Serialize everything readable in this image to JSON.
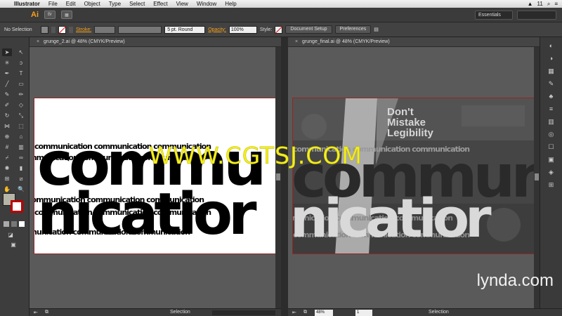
{
  "menubar": {
    "app": "Illustrator",
    "items": [
      "File",
      "Edit",
      "Object",
      "Type",
      "Select",
      "Effect",
      "View",
      "Window",
      "Help"
    ],
    "right_text": "11"
  },
  "appbar": {
    "logo": "Ai",
    "chip": "Br",
    "workspace": "Essentials"
  },
  "control": {
    "selection": "No Selection",
    "stroke_label": "Stroke:",
    "brush": "5 pt. Round",
    "opacity_label": "Opacity:",
    "opacity_value": "100%",
    "style_label": "Style:",
    "document_setup": "Document Setup",
    "preferences": "Preferences"
  },
  "documents": {
    "left_tab": "grunge_2.ai @ 48% (CMYK/Preview)",
    "right_tab": "grunge_final.ai @ 48% (CMYK/Preview)"
  },
  "artwork": {
    "word_line1": "commu",
    "word_line2": "nicatior",
    "right_line1": "commun",
    "right_line2": "nicatior",
    "texture_text": "communication communication communication",
    "tagline": [
      "Don't",
      "Mistake",
      "Legibility"
    ]
  },
  "watermark": "WWW.CGTSJ.COM",
  "lynda": "lynda.com",
  "status": {
    "left_mode": "Selection",
    "right_zoom": "48%",
    "right_page": "1",
    "right_mode": "Selection"
  },
  "colors": {
    "accent": "#f7a21b",
    "artboard_border": "#9a2222",
    "watermark": "#f2ee20"
  }
}
